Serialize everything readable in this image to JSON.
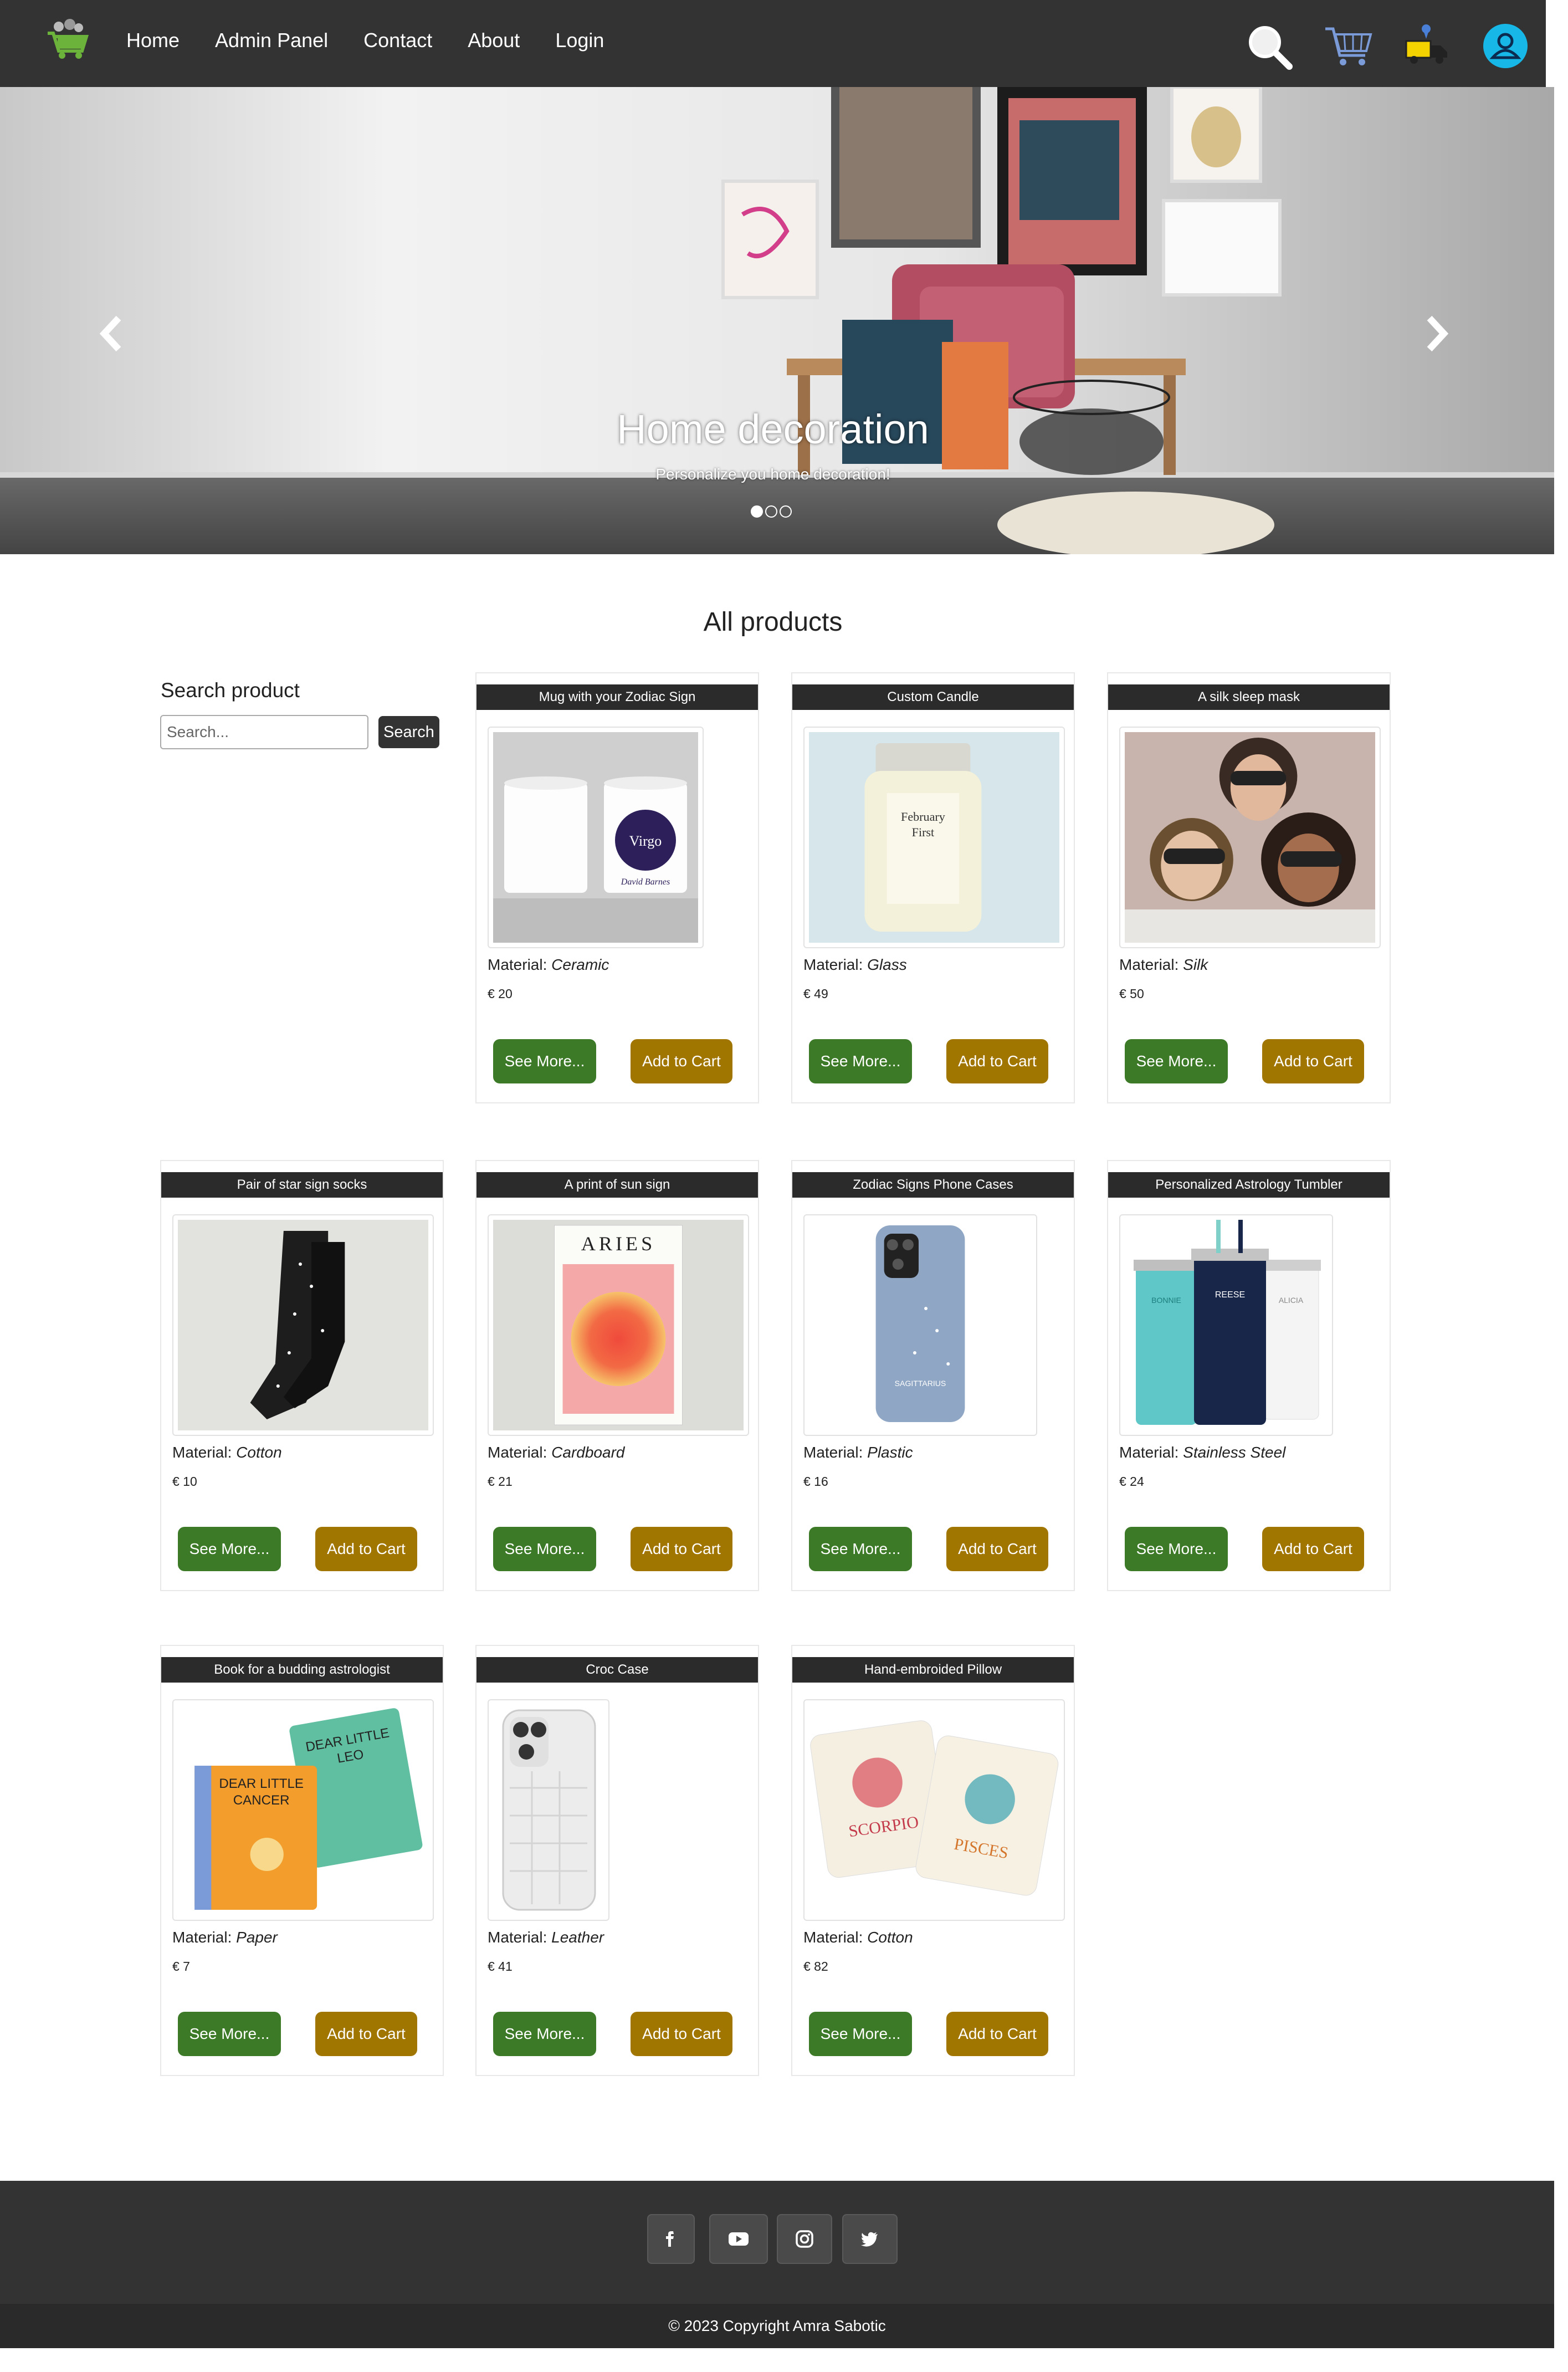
{
  "nav": {
    "links": [
      "Home",
      "Admin Panel",
      "Contact",
      "About",
      "Login"
    ],
    "icons": [
      "search-icon",
      "cart-icon",
      "delivery-icon",
      "user-icon"
    ]
  },
  "carousel": {
    "title": "Home decoration",
    "subtitle": "Personalize you home decoration!",
    "slides": 3,
    "active_slide": 1
  },
  "products_section": {
    "title": "All products",
    "search_label": "Search product",
    "search_placeholder": "Search...",
    "search_button": "Search"
  },
  "products": [
    {
      "name": "Mug with your Zodiac Sign",
      "material_label": "Material:",
      "material": "Ceramic",
      "price": "€ 20",
      "more": "See More...",
      "cart": "Add to Cart"
    },
    {
      "name": "Custom Candle",
      "material_label": "Material:",
      "material": "Glass",
      "price": "€ 49",
      "more": "See More...",
      "cart": "Add to Cart"
    },
    {
      "name": "A silk sleep mask",
      "material_label": "Material:",
      "material": "Silk",
      "price": "€ 50",
      "more": "See More...",
      "cart": "Add to Cart"
    },
    {
      "name": "Pair of star sign socks",
      "material_label": "Material:",
      "material": "Cotton",
      "price": "€ 10",
      "more": "See More...",
      "cart": "Add to Cart"
    },
    {
      "name": "A print of sun sign",
      "material_label": "Material:",
      "material": "Cardboard",
      "price": "€ 21",
      "more": "See More...",
      "cart": "Add to Cart"
    },
    {
      "name": "Zodiac Signs Phone Cases",
      "material_label": "Material:",
      "material": "Plastic",
      "price": "€ 16",
      "more": "See More...",
      "cart": "Add to Cart"
    },
    {
      "name": "Personalized Astrology Tumbler",
      "material_label": "Material:",
      "material": "Stainless Steel",
      "price": "€ 24",
      "more": "See More...",
      "cart": "Add to Cart"
    },
    {
      "name": "Book for a budding astrologist",
      "material_label": "Material:",
      "material": "Paper",
      "price": "€ 7",
      "more": "See More...",
      "cart": "Add to Cart"
    },
    {
      "name": "Croc Case",
      "material_label": "Material:",
      "material": "Leather",
      "price": "€ 41",
      "more": "See More...",
      "cart": "Add to Cart"
    },
    {
      "name": "Hand-embroided Pillow",
      "material_label": "Material:",
      "material": "Cotton",
      "price": "€ 82",
      "more": "See More...",
      "cart": "Add to Cart"
    }
  ],
  "image_text": {
    "mug_sign": "Virgo",
    "mug_name": "David Barnes",
    "candle_line1": "February",
    "candle_line2": "First",
    "print_title": "ARIES",
    "phone_sign": "SAGITTARIUS",
    "tumbler_names": [
      "BONNIE",
      "REESE",
      "ALICIA"
    ],
    "book1_title": [
      "DEAR LITTLE",
      "CANCER"
    ],
    "book2_title": [
      "DEAR LITTLE",
      "LEO"
    ],
    "pillow1": "SCORPIO",
    "pillow2": "PISCES"
  },
  "footer": {
    "social": [
      "facebook-icon",
      "youtube-icon",
      "instagram-icon",
      "twitter-icon"
    ],
    "copyright": "© 2023 Copyright Amra Sabotic"
  },
  "colors": {
    "navbar": "#333333",
    "see_more": "#3d7a28",
    "add_to_cart": "#a07500",
    "card_title": "#2b2b2b"
  }
}
